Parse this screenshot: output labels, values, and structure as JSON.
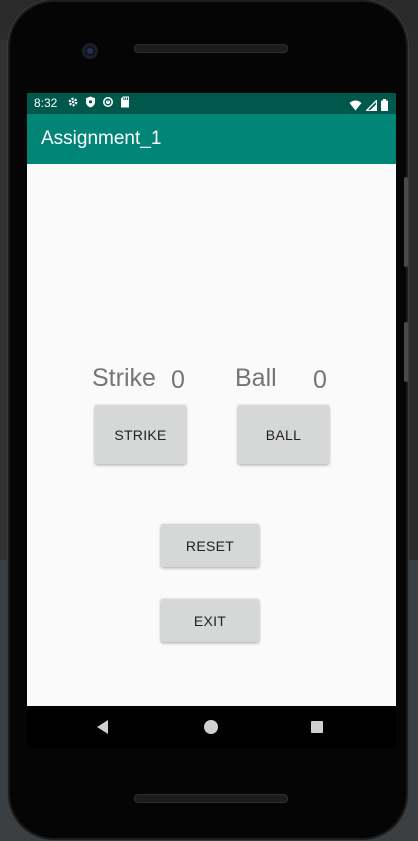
{
  "status_bar": {
    "time": "8:32",
    "icons_left": [
      "settings-icon",
      "shield-icon",
      "sync-icon",
      "sd-card-icon"
    ],
    "icons_right": [
      "wifi-icon",
      "signal-icon",
      "battery-icon"
    ]
  },
  "app_bar": {
    "title": "Assignment_1"
  },
  "scoreboard": {
    "strike_label": "Strike",
    "strike_count": "0",
    "ball_label": "Ball",
    "ball_count": "0"
  },
  "buttons": {
    "strike": "STRIKE",
    "ball": "BALL",
    "reset": "RESET",
    "exit": "EXIT"
  },
  "nav_bar": {
    "icons": [
      "back-icon",
      "home-icon",
      "recents-icon"
    ]
  },
  "colors": {
    "primary": "#008577",
    "primary_dark": "#00574B",
    "background": "#FAFAFA",
    "button": "#D6D7D7",
    "label_text": "#757575"
  }
}
